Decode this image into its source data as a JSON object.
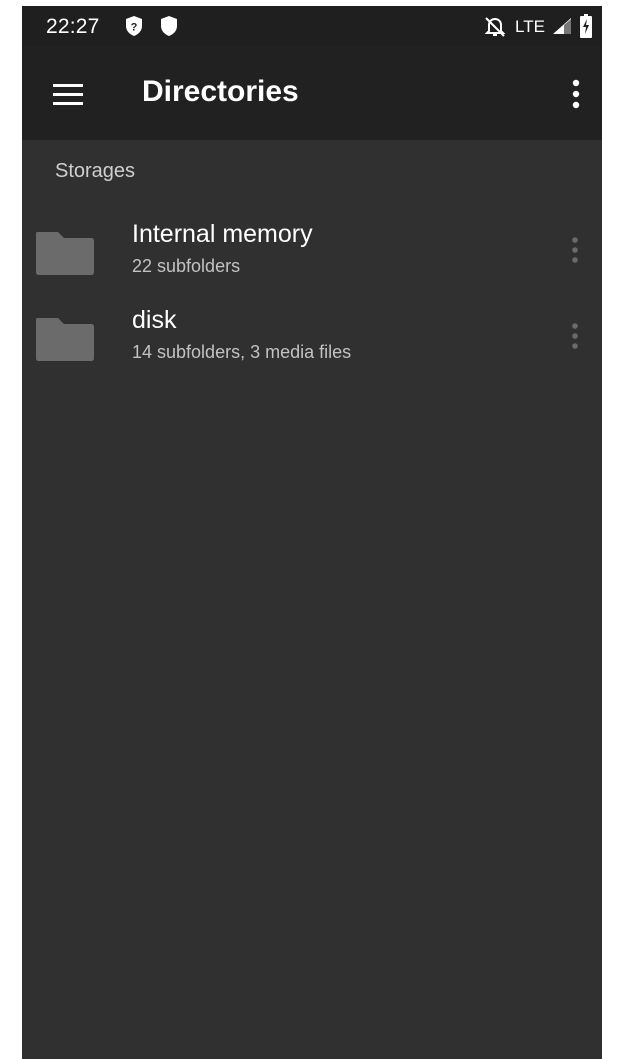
{
  "status_bar": {
    "time": "22:27",
    "left_icons": [
      "help-badge-icon",
      "shield-icon"
    ],
    "right_icons": [
      "alarm-off-icon",
      "signal-icon",
      "battery-charging-icon"
    ],
    "network": "LTE"
  },
  "app_bar": {
    "title": "Directories",
    "menu_icon": "hamburger-menu-icon",
    "overflow_icon": "more-vert-icon"
  },
  "section": {
    "header": "Storages"
  },
  "storages": [
    {
      "title": "Internal memory",
      "subtitle": "22 subfolders",
      "icon": "folder-icon"
    },
    {
      "title": "disk",
      "subtitle": "14 subfolders, 3 media files",
      "icon": "folder-icon"
    }
  ],
  "colors": {
    "background": "#303030",
    "app_bar": "#212121",
    "status_bar": "#1f1f1f",
    "folder": "#6b6b6b"
  }
}
